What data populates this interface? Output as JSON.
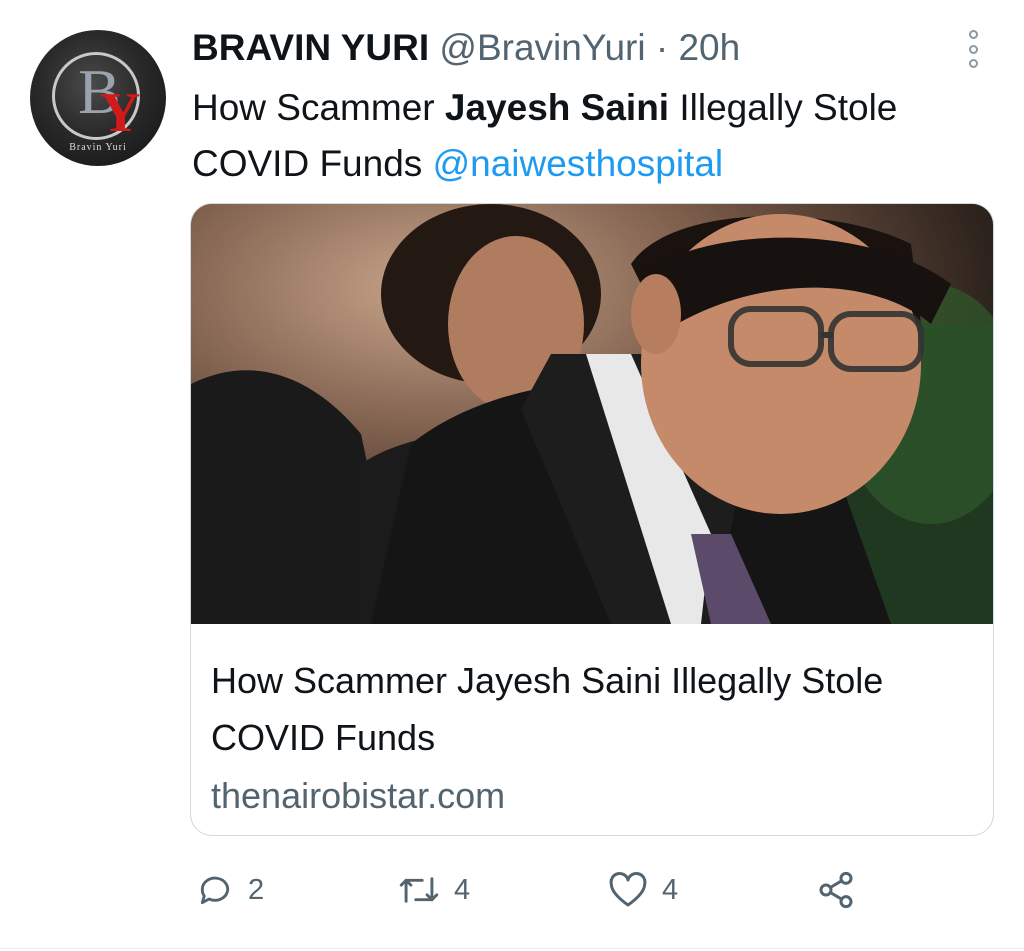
{
  "tweet": {
    "display_name": "BRAVIN YURI",
    "handle": "@BravinYuri",
    "separator": "·",
    "time": "20h",
    "text_part1": "How Scammer ",
    "text_bold": "Jayesh Saini",
    "text_part2": " Illegally Stole COVID Funds ",
    "mention": "@naiwesthospital"
  },
  "avatar": {
    "letter_b": "B",
    "letter_y": "Y",
    "brand_text": "Bravin Yuri"
  },
  "card": {
    "title": "How Scammer Jayesh Saini Illegally Stole COVID Funds",
    "domain": "thenairobistar.com"
  },
  "actions": {
    "replies": "2",
    "retweets": "4",
    "likes": "4"
  },
  "icons": [
    "more-icon",
    "reply-icon",
    "retweet-icon",
    "like-icon",
    "share-icon"
  ],
  "colors": {
    "link": "#1d9bf0",
    "secondary_text": "#536471",
    "border": "#cfd9de"
  }
}
